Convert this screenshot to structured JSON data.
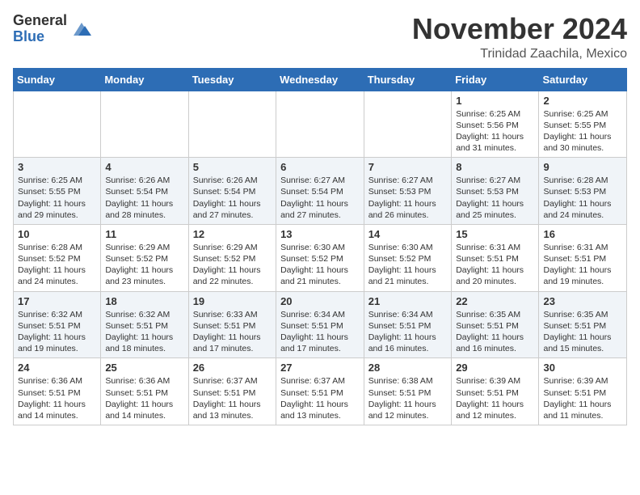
{
  "header": {
    "logo_general": "General",
    "logo_blue": "Blue",
    "month_title": "November 2024",
    "location": "Trinidad Zaachila, Mexico"
  },
  "calendar": {
    "weekdays": [
      "Sunday",
      "Monday",
      "Tuesday",
      "Wednesday",
      "Thursday",
      "Friday",
      "Saturday"
    ],
    "weeks": [
      [
        {
          "day": "",
          "info": ""
        },
        {
          "day": "",
          "info": ""
        },
        {
          "day": "",
          "info": ""
        },
        {
          "day": "",
          "info": ""
        },
        {
          "day": "",
          "info": ""
        },
        {
          "day": "1",
          "info": "Sunrise: 6:25 AM\nSunset: 5:56 PM\nDaylight: 11 hours and 31 minutes."
        },
        {
          "day": "2",
          "info": "Sunrise: 6:25 AM\nSunset: 5:55 PM\nDaylight: 11 hours and 30 minutes."
        }
      ],
      [
        {
          "day": "3",
          "info": "Sunrise: 6:25 AM\nSunset: 5:55 PM\nDaylight: 11 hours and 29 minutes."
        },
        {
          "day": "4",
          "info": "Sunrise: 6:26 AM\nSunset: 5:54 PM\nDaylight: 11 hours and 28 minutes."
        },
        {
          "day": "5",
          "info": "Sunrise: 6:26 AM\nSunset: 5:54 PM\nDaylight: 11 hours and 27 minutes."
        },
        {
          "day": "6",
          "info": "Sunrise: 6:27 AM\nSunset: 5:54 PM\nDaylight: 11 hours and 27 minutes."
        },
        {
          "day": "7",
          "info": "Sunrise: 6:27 AM\nSunset: 5:53 PM\nDaylight: 11 hours and 26 minutes."
        },
        {
          "day": "8",
          "info": "Sunrise: 6:27 AM\nSunset: 5:53 PM\nDaylight: 11 hours and 25 minutes."
        },
        {
          "day": "9",
          "info": "Sunrise: 6:28 AM\nSunset: 5:53 PM\nDaylight: 11 hours and 24 minutes."
        }
      ],
      [
        {
          "day": "10",
          "info": "Sunrise: 6:28 AM\nSunset: 5:52 PM\nDaylight: 11 hours and 24 minutes."
        },
        {
          "day": "11",
          "info": "Sunrise: 6:29 AM\nSunset: 5:52 PM\nDaylight: 11 hours and 23 minutes."
        },
        {
          "day": "12",
          "info": "Sunrise: 6:29 AM\nSunset: 5:52 PM\nDaylight: 11 hours and 22 minutes."
        },
        {
          "day": "13",
          "info": "Sunrise: 6:30 AM\nSunset: 5:52 PM\nDaylight: 11 hours and 21 minutes."
        },
        {
          "day": "14",
          "info": "Sunrise: 6:30 AM\nSunset: 5:52 PM\nDaylight: 11 hours and 21 minutes."
        },
        {
          "day": "15",
          "info": "Sunrise: 6:31 AM\nSunset: 5:51 PM\nDaylight: 11 hours and 20 minutes."
        },
        {
          "day": "16",
          "info": "Sunrise: 6:31 AM\nSunset: 5:51 PM\nDaylight: 11 hours and 19 minutes."
        }
      ],
      [
        {
          "day": "17",
          "info": "Sunrise: 6:32 AM\nSunset: 5:51 PM\nDaylight: 11 hours and 19 minutes."
        },
        {
          "day": "18",
          "info": "Sunrise: 6:32 AM\nSunset: 5:51 PM\nDaylight: 11 hours and 18 minutes."
        },
        {
          "day": "19",
          "info": "Sunrise: 6:33 AM\nSunset: 5:51 PM\nDaylight: 11 hours and 17 minutes."
        },
        {
          "day": "20",
          "info": "Sunrise: 6:34 AM\nSunset: 5:51 PM\nDaylight: 11 hours and 17 minutes."
        },
        {
          "day": "21",
          "info": "Sunrise: 6:34 AM\nSunset: 5:51 PM\nDaylight: 11 hours and 16 minutes."
        },
        {
          "day": "22",
          "info": "Sunrise: 6:35 AM\nSunset: 5:51 PM\nDaylight: 11 hours and 16 minutes."
        },
        {
          "day": "23",
          "info": "Sunrise: 6:35 AM\nSunset: 5:51 PM\nDaylight: 11 hours and 15 minutes."
        }
      ],
      [
        {
          "day": "24",
          "info": "Sunrise: 6:36 AM\nSunset: 5:51 PM\nDaylight: 11 hours and 14 minutes."
        },
        {
          "day": "25",
          "info": "Sunrise: 6:36 AM\nSunset: 5:51 PM\nDaylight: 11 hours and 14 minutes."
        },
        {
          "day": "26",
          "info": "Sunrise: 6:37 AM\nSunset: 5:51 PM\nDaylight: 11 hours and 13 minutes."
        },
        {
          "day": "27",
          "info": "Sunrise: 6:37 AM\nSunset: 5:51 PM\nDaylight: 11 hours and 13 minutes."
        },
        {
          "day": "28",
          "info": "Sunrise: 6:38 AM\nSunset: 5:51 PM\nDaylight: 11 hours and 12 minutes."
        },
        {
          "day": "29",
          "info": "Sunrise: 6:39 AM\nSunset: 5:51 PM\nDaylight: 11 hours and 12 minutes."
        },
        {
          "day": "30",
          "info": "Sunrise: 6:39 AM\nSunset: 5:51 PM\nDaylight: 11 hours and 11 minutes."
        }
      ]
    ]
  }
}
